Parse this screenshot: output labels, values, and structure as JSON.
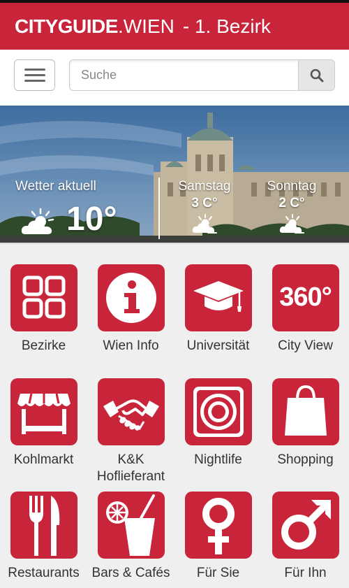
{
  "header": {
    "brand_bold": "CITYGUIDE",
    "brand_light": ".WIEN",
    "subtitle": "- 1. Bezirk",
    "brand_color": "#c8243a"
  },
  "search": {
    "placeholder": "Suche"
  },
  "weather": {
    "current_label": "Wetter aktuell",
    "current_temp": "10°",
    "forecast": [
      {
        "day": "Samstag",
        "temp": "3 C°"
      },
      {
        "day": "Sonntag",
        "temp": "2 C°"
      }
    ]
  },
  "tiles": [
    {
      "label": "Bezirke",
      "icon": "grid-icon"
    },
    {
      "label": "Wien Info",
      "icon": "info-icon"
    },
    {
      "label": "Universität",
      "icon": "graduation-cap-icon"
    },
    {
      "label": "City View",
      "icon": "360-icon",
      "icon_text": "360°"
    },
    {
      "label": "Kohlmarkt",
      "icon": "market-stall-icon"
    },
    {
      "label": "K&K Hoflieferant",
      "icon": "handshake-icon"
    },
    {
      "label": "Nightlife",
      "icon": "speaker-icon"
    },
    {
      "label": "Shopping",
      "icon": "shopping-bag-icon"
    },
    {
      "label": "Restaurants",
      "icon": "cutlery-icon"
    },
    {
      "label": "Bars & Cafés",
      "icon": "drink-icon"
    },
    {
      "label": "Für Sie",
      "icon": "female-icon"
    },
    {
      "label": "Für Ihn",
      "icon": "male-icon"
    }
  ]
}
